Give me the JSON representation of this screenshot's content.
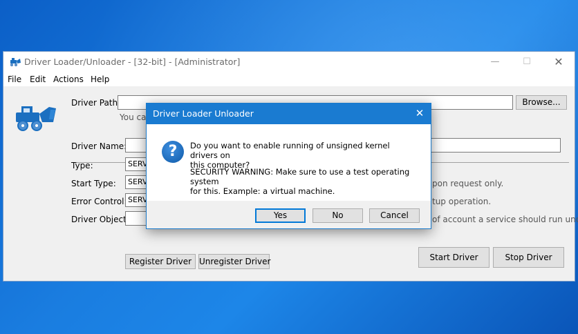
{
  "window": {
    "title": "Driver Loader/Unloader - [32-bit] - [Administrator]",
    "controls": {
      "minimize": "—",
      "maximize": "☐",
      "close": "✕"
    }
  },
  "menu": {
    "file": "File",
    "edit": "Edit",
    "actions": "Actions",
    "help": "Help"
  },
  "form": {
    "driver_path_label": "Driver Path:",
    "driver_path_value": "",
    "browse_label": "Browse...",
    "path_hint": "You can",
    "driver_name_label": "Driver Name:",
    "type_label": "Type:",
    "type_value": "SERVI",
    "start_type_label": "Start Type:",
    "start_type_value": "SERVI",
    "start_type_hint": "pon request only.",
    "error_control_label": "Error Control:",
    "error_control_value": "SERVI",
    "error_control_hint": "tup operation.",
    "driver_object_label": "Driver Object:",
    "driver_object_hint": "of account a service should run under.",
    "register_label": "Register Driver",
    "unregister_label": "Unregister Driver",
    "start_label": "Start Driver",
    "stop_label": "Stop Driver"
  },
  "dialog": {
    "title": "Driver Loader Unloader",
    "icon": "question-icon",
    "question_line1": "Do you want to enable running of unsigned kernel drivers on",
    "question_line2": "this computer?",
    "warning_line1": "SECURITY WARNING: Make sure to use a test operating system",
    "warning_line2": "for this. Example: a virtual machine.",
    "yes_label": "Yes",
    "no_label": "No",
    "cancel_label": "Cancel"
  },
  "colors": {
    "accent": "#1a7bd1",
    "desktop": "#1a7de0",
    "default_button_border": "#0078d7"
  }
}
